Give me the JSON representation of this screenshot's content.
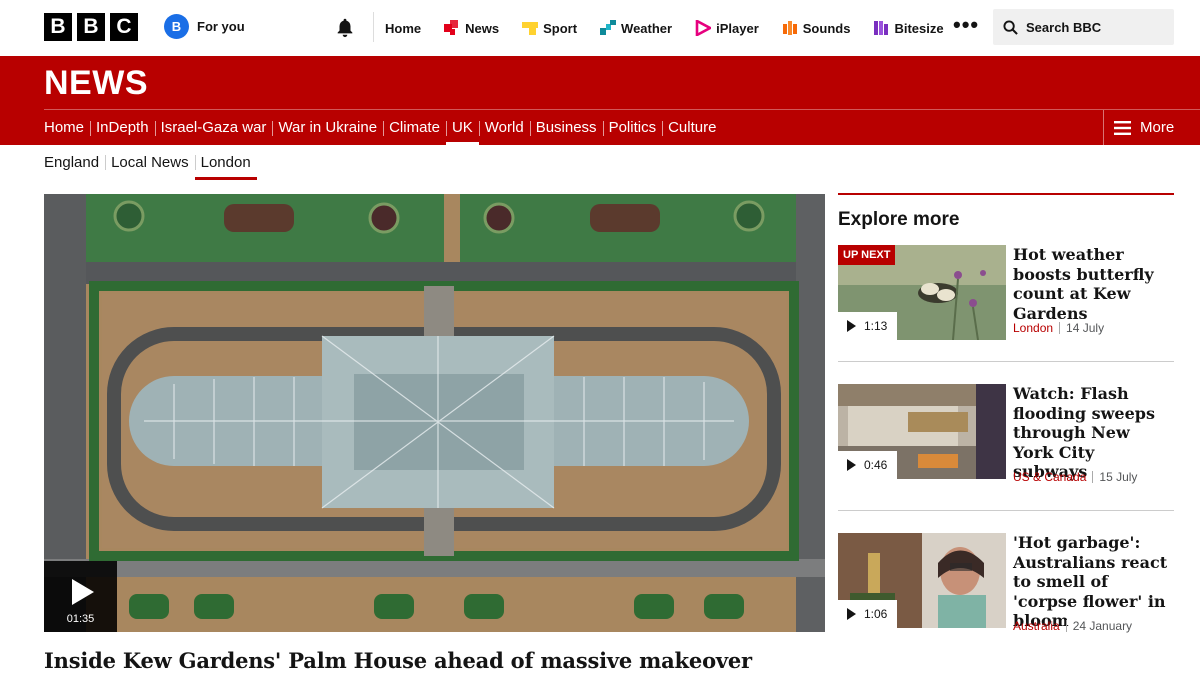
{
  "global_nav": {
    "logo": [
      "B",
      "B",
      "C"
    ],
    "for_you_initial": "B",
    "for_you_label": "For you",
    "items": [
      {
        "label": "Home",
        "icon": "none"
      },
      {
        "label": "News",
        "icon": "news-icon",
        "color": "#e2001a"
      },
      {
        "label": "Sport",
        "icon": "sport-icon",
        "color": "#ffd230"
      },
      {
        "label": "Weather",
        "icon": "weather-icon",
        "color": "#0f8a9a"
      },
      {
        "label": "iPlayer",
        "icon": "iplayer-icon",
        "color": "#e6007e"
      },
      {
        "label": "Sounds",
        "icon": "sounds-icon",
        "color": "#f66a08"
      },
      {
        "label": "Bitesize",
        "icon": "bitesize-icon",
        "color": "#7a2fbf"
      }
    ],
    "more_dots": "•••",
    "search_label": "Search BBC"
  },
  "news_header": {
    "brand": "NEWS",
    "sections": [
      "Home",
      "InDepth",
      "Israel-Gaza war",
      "War in Ukraine",
      "Climate",
      "UK",
      "World",
      "Business",
      "Politics",
      "Culture"
    ],
    "active_section": "UK",
    "more_label": "More",
    "brand_color": "#b80000"
  },
  "sub_nav": {
    "items": [
      "England",
      "Local News",
      "London"
    ],
    "active": "London"
  },
  "hero": {
    "duration": "01:35",
    "title": "Inside Kew Gardens' Palm House ahead of massive makeover"
  },
  "explore": {
    "heading": "Explore more",
    "cards": [
      {
        "badge": "UP NEXT",
        "duration": "1:13",
        "title": "Hot weather boosts butterfly count at Kew Gardens",
        "region": "London",
        "date": "14 July"
      },
      {
        "badge": "",
        "duration": "0:46",
        "title": "Watch: Flash flooding sweeps through New York City subways",
        "region": "US & Canada",
        "date": "15 July"
      },
      {
        "badge": "",
        "duration": "1:06",
        "title": "'Hot garbage': Australians react to smell of 'corpse flower' in bloom",
        "region": "Australia",
        "date": "24 January"
      }
    ]
  }
}
